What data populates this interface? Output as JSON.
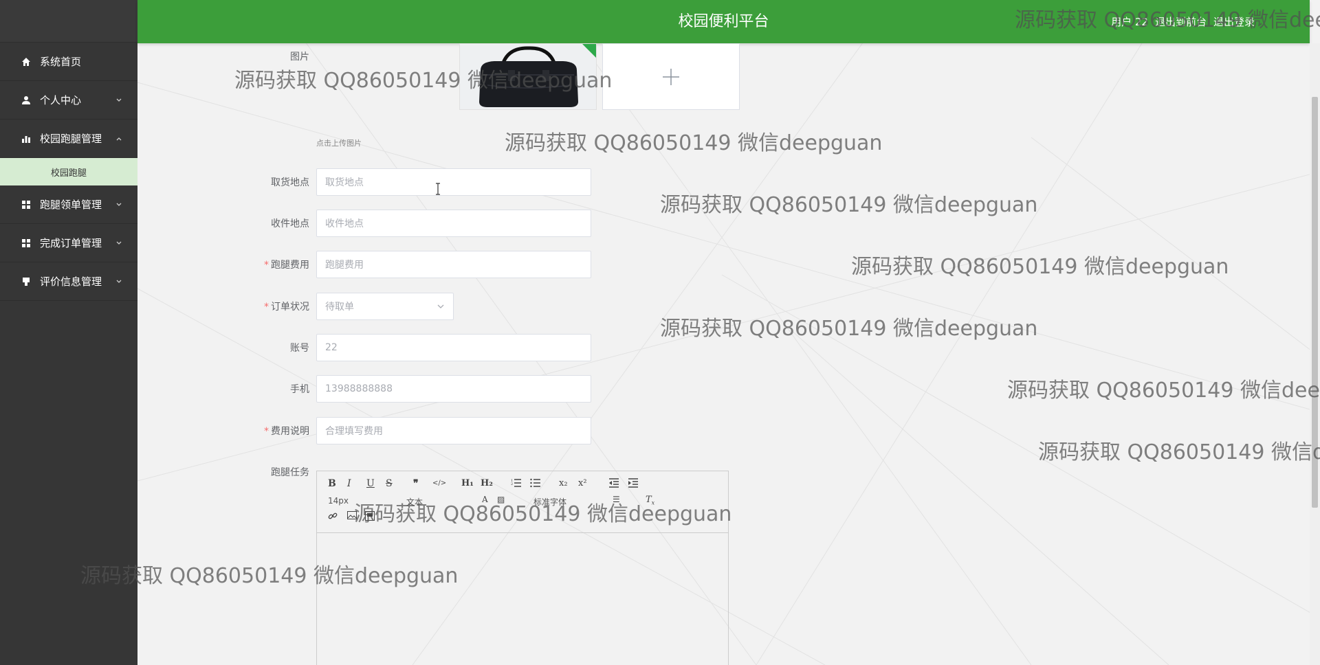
{
  "header": {
    "title": "校园便利平台",
    "user_label": "用户 22",
    "exit_front_label": "退出到前台",
    "logout_label": "退出登录"
  },
  "sidebar": {
    "items": [
      {
        "label": "系统首页",
        "icon": "home-icon"
      },
      {
        "label": "个人中心",
        "icon": "user-icon"
      },
      {
        "label": "校园跑腿管理",
        "icon": "bar-chart-icon"
      },
      {
        "label": "跑腿领单管理",
        "icon": "grid-icon"
      },
      {
        "label": "完成订单管理",
        "icon": "grid-icon"
      },
      {
        "label": "评价信息管理",
        "icon": "comment-icon"
      }
    ],
    "subitem": "校园跑腿"
  },
  "form": {
    "image_label": "图片",
    "upload_hint": "点击上传图片",
    "pickup_label": "取货地点",
    "pickup_placeholder": "取货地点",
    "receive_label": "收件地点",
    "receive_placeholder": "收件地点",
    "fee_label": "跑腿费用",
    "fee_placeholder": "跑腿费用",
    "status_label": "订单状况",
    "status_value": "待取单",
    "account_label": "账号",
    "account_value": "22",
    "phone_label": "手机",
    "phone_value": "13988888888",
    "fee_desc_label": "费用说明",
    "fee_desc_placeholder": "合理填写费用",
    "task_label": "跑腿任务"
  },
  "editor": {
    "font_size": "14px",
    "paragraph": "文本",
    "font_family": "标准字体",
    "buttons": [
      "B",
      "I",
      "U",
      "S",
      "❞",
      "</>",
      "H1",
      "H2",
      "ol",
      "ul",
      "x₂",
      "x²",
      "outdent",
      "indent",
      "link",
      "image",
      "video",
      "font-color",
      "bg-color",
      "align",
      "clear"
    ]
  },
  "watermark": "源码获取 QQ86050149 微信deepguan",
  "colors": {
    "header_bg": "#3c9e3a",
    "sidebar_bg": "#363636",
    "submenu_bg": "#d6ecd2",
    "required": "#f56c6c"
  }
}
